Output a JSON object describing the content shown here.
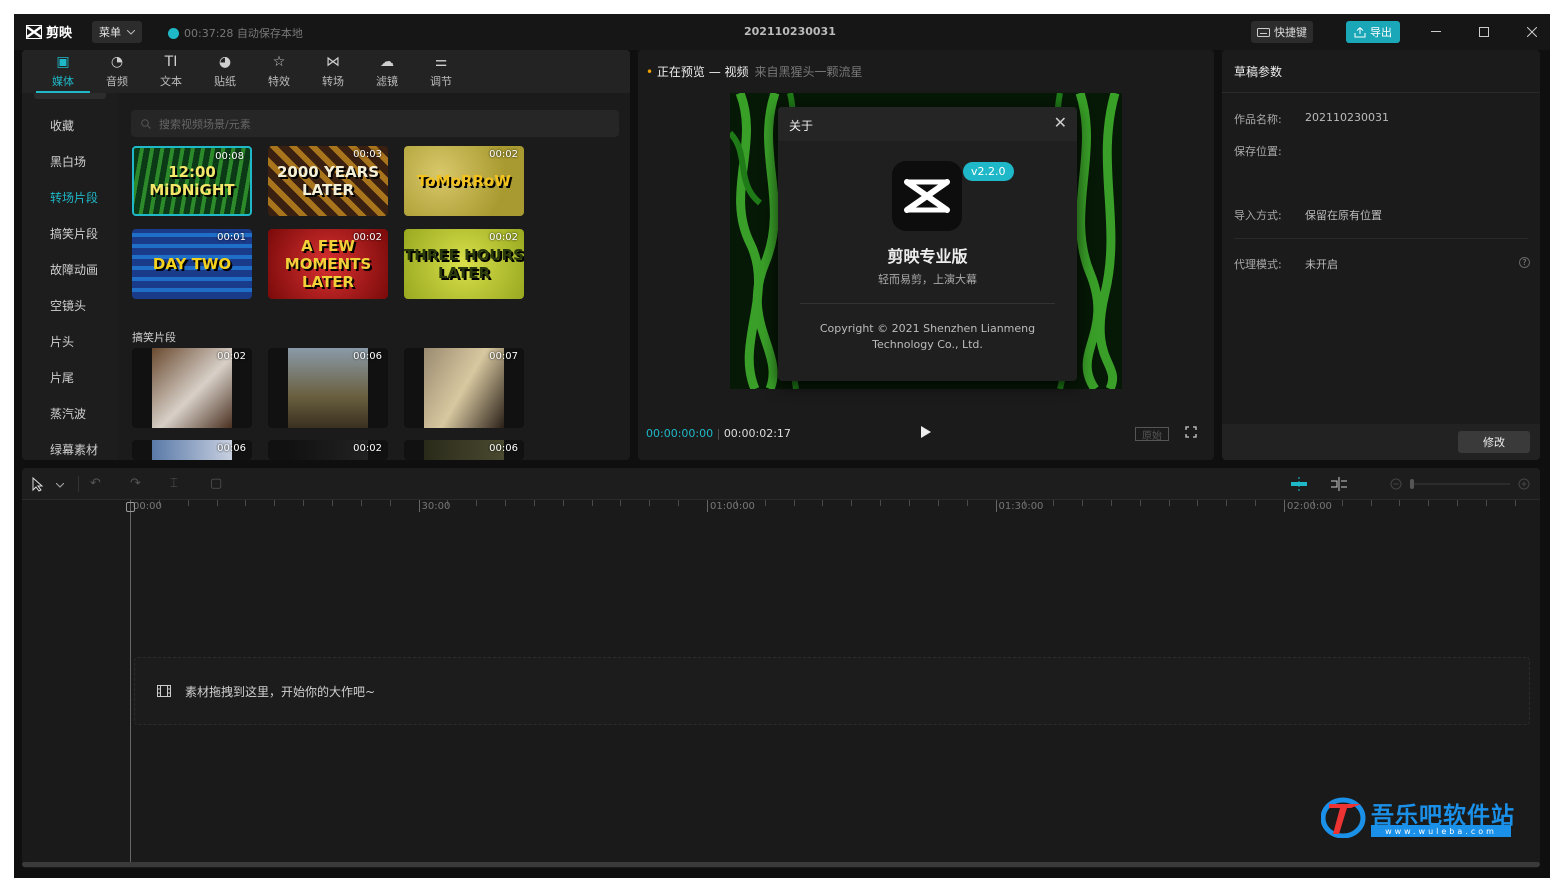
{
  "app": {
    "name": "剪映",
    "project_title": "202110230031",
    "menu_label": "菜单",
    "save_status": "00:37:28 自动保存本地",
    "shortcut_label": "快捷键",
    "export_label": "导出"
  },
  "toolbar": {
    "tabs": [
      {
        "label": "媒体",
        "icon": "media-icon",
        "active": true
      },
      {
        "label": "音频",
        "icon": "audio-icon"
      },
      {
        "label": "文本",
        "icon": "text-icon"
      },
      {
        "label": "贴纸",
        "icon": "sticker-icon"
      },
      {
        "label": "特效",
        "icon": "effects-icon"
      },
      {
        "label": "转场",
        "icon": "transition-icon"
      },
      {
        "label": "滤镜",
        "icon": "filter-icon"
      },
      {
        "label": "调节",
        "icon": "adjust-icon"
      }
    ]
  },
  "sidebar": {
    "items": [
      {
        "label": "收藏"
      },
      {
        "label": "黑白场"
      },
      {
        "label": "转场片段",
        "active": true
      },
      {
        "label": "搞笑片段"
      },
      {
        "label": "故障动画"
      },
      {
        "label": "空镜头"
      },
      {
        "label": "片头"
      },
      {
        "label": "片尾"
      },
      {
        "label": "蒸汽波"
      },
      {
        "label": "绿幕素材"
      }
    ]
  },
  "search": {
    "placeholder": "搜索视频场景/元素"
  },
  "media": {
    "transition_clips": [
      {
        "title": "12:00 MiDNiGHT",
        "duration": "00:08"
      },
      {
        "title": "2000 YEARS LATER",
        "duration": "00:03"
      },
      {
        "title": "ToMoRRoW",
        "duration": "00:02"
      },
      {
        "title": "DAY TWO",
        "duration": "00:01"
      },
      {
        "title": "A FEW MOMENTS LATER",
        "duration": "00:02"
      },
      {
        "title": "THREE HOURS LATER",
        "duration": "00:02"
      }
    ],
    "funny_category_label": "搞笑片段",
    "funny_clips": [
      {
        "duration": "00:02"
      },
      {
        "duration": "00:06"
      },
      {
        "duration": "00:07"
      },
      {
        "duration": "00:06"
      },
      {
        "duration": "00:02"
      },
      {
        "duration": "00:06"
      }
    ]
  },
  "preview": {
    "label": "正在预览 — 视频",
    "source": "来自黑猩头一颗流星",
    "current_time": "00:00:00:00",
    "total_time": "00:00:02:17",
    "original_label": "原始"
  },
  "about": {
    "title": "关于",
    "version": "v2.2.0",
    "app_name": "剪映专业版",
    "tagline": "轻而易剪，上演大幕",
    "copyright_line1": "Copyright © 2021 Shenzhen Lianmeng",
    "copyright_line2": "Technology Co., Ltd."
  },
  "params": {
    "title": "草稿参数",
    "rows": [
      {
        "label": "作品名称:",
        "value": "202110230031"
      },
      {
        "label": "保存位置:",
        "value": ""
      },
      {
        "label": "导入方式:",
        "value": "保留在原有位置"
      },
      {
        "label": "代理模式:",
        "value": "未开启"
      }
    ],
    "modify_label": "修改"
  },
  "timeline": {
    "ruler_labels": [
      "00:00",
      "30:00",
      "01:00:00",
      "01:30:00",
      "02:00:00"
    ],
    "drop_hint": "素材拖拽到这里，开始你的大作吧~"
  },
  "watermark": {
    "text": "吾乐吧软件站",
    "url": "www.wuleba.com"
  },
  "colors": {
    "accent": "#1fb8c8",
    "background": "#0f0f0f",
    "panel": "#1b1b1b"
  }
}
